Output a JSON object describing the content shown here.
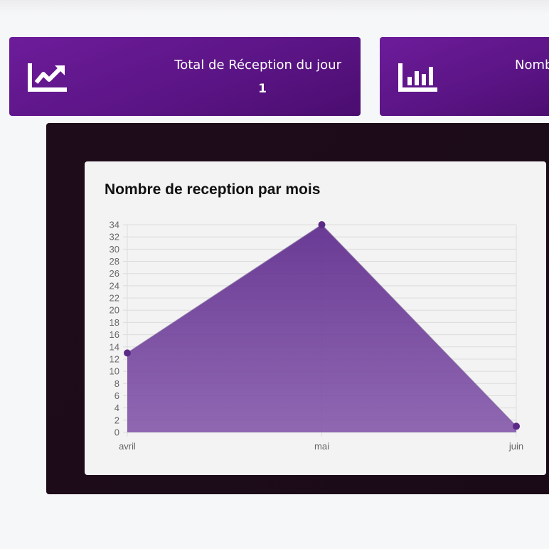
{
  "cards": [
    {
      "title": "Total de Réception du jour",
      "value": "1",
      "icon": "chart-line-up-icon"
    },
    {
      "title": "Nomb",
      "icon": "chart-bar-icon"
    }
  ],
  "colors": {
    "card_purple": "#5a1484",
    "dark_panel": "#1f0c1a",
    "chart_fill": "#7b4a9e",
    "chart_point": "#5b2a86"
  },
  "chart_data": {
    "type": "area",
    "title": "Nombre de reception par mois",
    "categories": [
      "avril",
      "mai",
      "juin"
    ],
    "values": [
      13,
      34,
      1
    ],
    "ylim": [
      0,
      34
    ],
    "yticks": [
      0,
      2,
      4,
      6,
      8,
      10,
      12,
      14,
      16,
      18,
      20,
      22,
      24,
      26,
      28,
      30,
      32,
      34
    ],
    "grid": true
  }
}
